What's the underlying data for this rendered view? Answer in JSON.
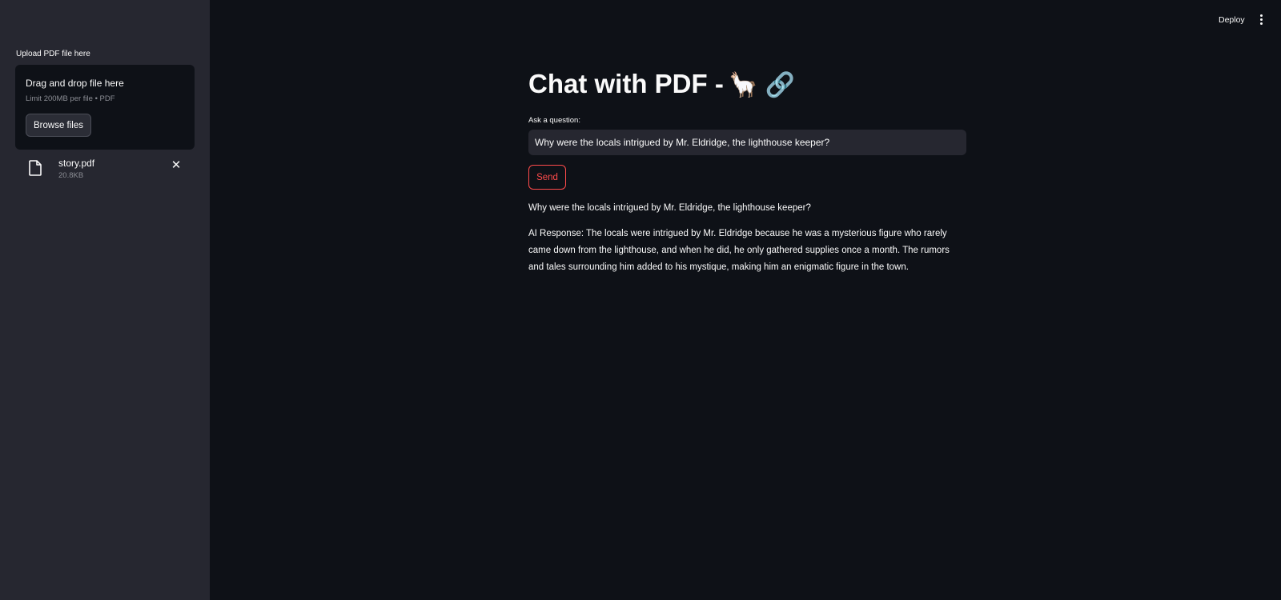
{
  "header": {
    "deploy_label": "Deploy",
    "menu_icon": "more-vert-icon"
  },
  "sidebar": {
    "upload_label": "Upload PDF file here",
    "dropzone": {
      "title": "Drag and drop file here",
      "limit": "Limit 200MB per file • PDF",
      "browse_label": "Browse files"
    },
    "file": {
      "icon": "file-icon",
      "name": "story.pdf",
      "size": "20.8KB",
      "remove_icon": "close-icon"
    }
  },
  "main": {
    "title": "Chat with PDF -",
    "title_emojis": "🦙 🔗",
    "question_label": "Ask a question:",
    "question_value": "Why were the locals intrigued by Mr. Eldridge, the lighthouse keeper?",
    "send_label": "Send",
    "question_echo": "Why were the locals intrigued by Mr. Eldridge, the lighthouse keeper?",
    "ai_response": "AI Response: The locals were intrigued by Mr. Eldridge because he was a mysterious figure who rarely came down from the lighthouse, and when he did, he only gathered supplies once a month. The rumors and tales surrounding him added to his mystique, making him an enigmatic figure in the town."
  },
  "colors": {
    "background": "#0e1117",
    "sidebar": "#262730",
    "accent": "#ff4b4b",
    "text": "#fafafa",
    "muted": "#8b8d94"
  }
}
